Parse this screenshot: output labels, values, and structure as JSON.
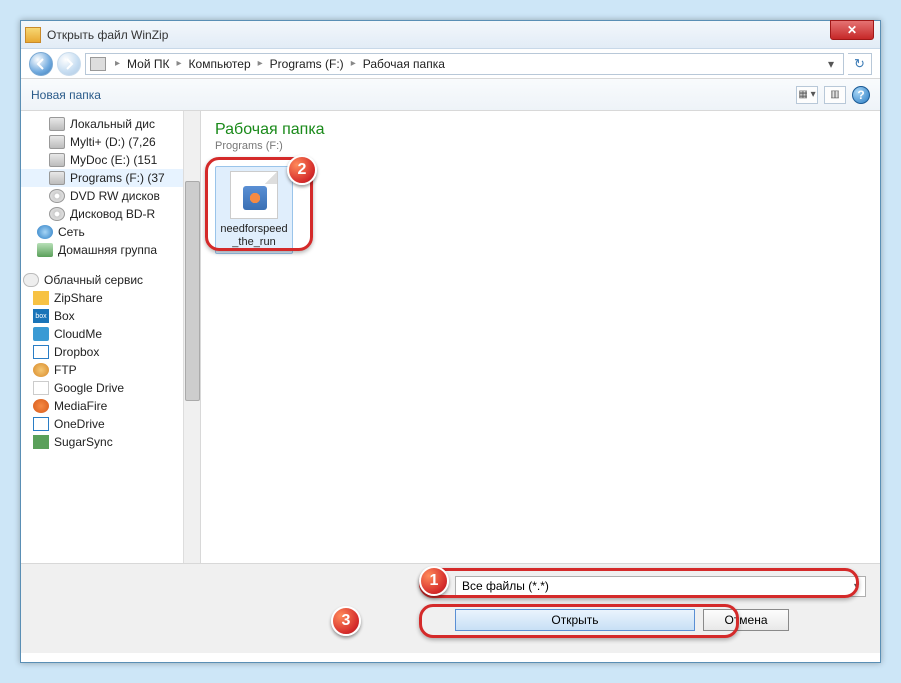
{
  "window": {
    "title": "Открыть файл WinZip"
  },
  "breadcrumb": {
    "items": [
      "Мой ПК",
      "Компьютер",
      "Programs (F:)",
      "Рабочая папка"
    ]
  },
  "toolbar": {
    "new_folder": "Новая папка"
  },
  "sidebar": {
    "drives": [
      {
        "label": "Локальный дис"
      },
      {
        "label": "Mylti+ (D:) (7,26"
      },
      {
        "label": "MyDoc (E:) (151"
      },
      {
        "label": "Programs (F:) (37",
        "selected": true
      },
      {
        "label": "DVD RW дисков"
      },
      {
        "label": "Дисковод BD-R"
      }
    ],
    "network": [
      {
        "label": "Сеть"
      },
      {
        "label": "Домашняя группа"
      }
    ],
    "cloud_header": "Облачный сервис",
    "cloud": [
      {
        "label": "ZipShare",
        "cls": "zip"
      },
      {
        "label": "Box",
        "cls": "box"
      },
      {
        "label": "CloudMe",
        "cls": "cm"
      },
      {
        "label": "Dropbox",
        "cls": "db"
      },
      {
        "label": "FTP",
        "cls": "ftp"
      },
      {
        "label": "Google Drive",
        "cls": "gd"
      },
      {
        "label": "MediaFire",
        "cls": "mf"
      },
      {
        "label": "OneDrive",
        "cls": "od"
      },
      {
        "label": "SugarSync",
        "cls": "sc"
      }
    ]
  },
  "main": {
    "heading": "Рабочая папка",
    "subtitle": "Programs (F:)",
    "files": [
      {
        "name": "needforspeed_the_run",
        "selected": true
      }
    ]
  },
  "footer": {
    "filetype": "Все файлы (*.*)",
    "open": "Открыть",
    "cancel": "Отмена"
  },
  "badges": {
    "b1": "1",
    "b2": "2",
    "b3": "3"
  }
}
